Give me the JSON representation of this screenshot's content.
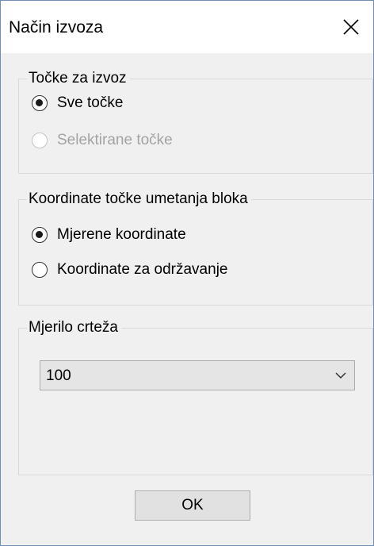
{
  "window": {
    "title": "Način izvoza",
    "close_glyph": "close-icon"
  },
  "groups": {
    "export_points": {
      "legend": "Točke za izvoz",
      "options": [
        {
          "label": "Sve točke",
          "checked": true,
          "disabled": false
        },
        {
          "label": "Selektirane točke",
          "checked": false,
          "disabled": true
        }
      ]
    },
    "block_coordinates": {
      "legend": "Koordinate točke umetanja bloka",
      "options": [
        {
          "label": "Mjerene koordinate",
          "checked": true,
          "disabled": false
        },
        {
          "label": "Koordinate za održavanje",
          "checked": false,
          "disabled": false
        }
      ]
    },
    "drawing_scale": {
      "legend": "Mjerilo crteža",
      "selected": "100"
    }
  },
  "buttons": {
    "ok_label": "OK"
  },
  "colors": {
    "window_border": "#6f8fb4",
    "dialog_background": "#f0f0f0",
    "disabled_text": "#a3a3a3"
  }
}
